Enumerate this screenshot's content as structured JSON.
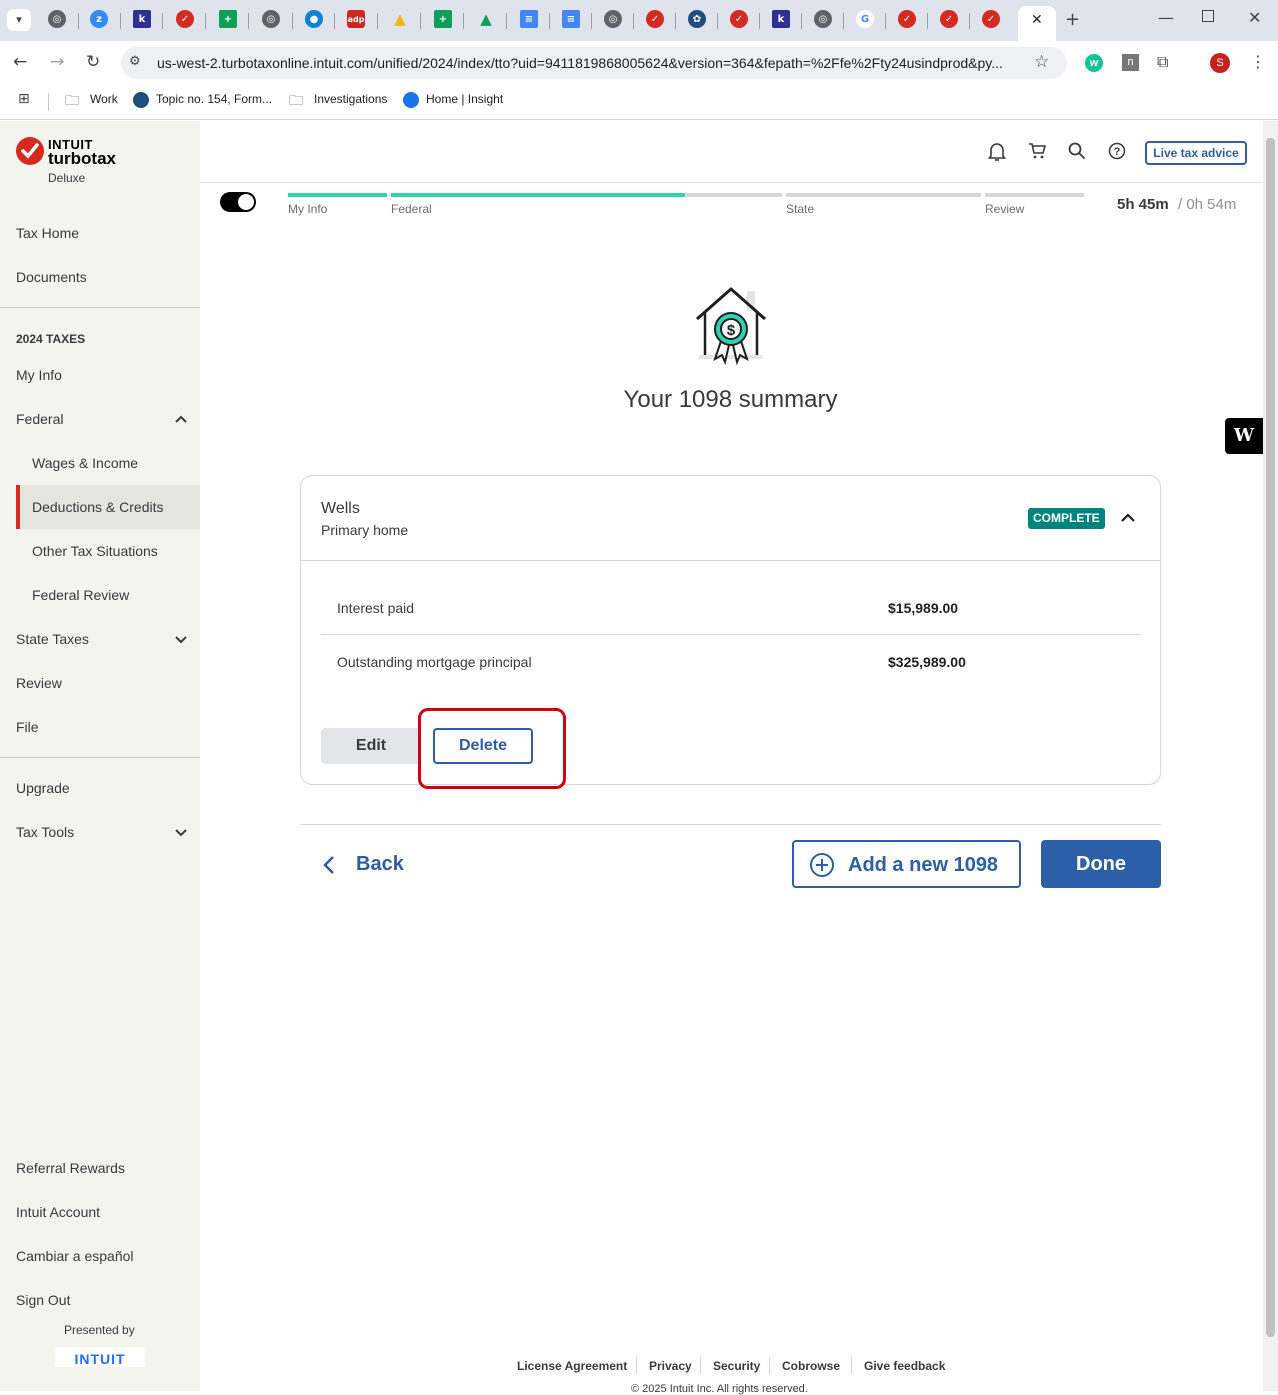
{
  "browser": {
    "url": "us-west-2.turbotaxonline.intuit.com/unified/2024/index/tto?uid=9411819868005624&version=364&fepath=%2Ffe%2Fty24usindprod&py...",
    "bookmarks": [
      {
        "label": "Work"
      },
      {
        "label": "Topic no. 154, Form..."
      },
      {
        "label": "Investigations"
      },
      {
        "label": "Home | Insight"
      }
    ],
    "profile_initial": "S"
  },
  "brand": {
    "intuit": "INTUIT",
    "name": "turbotax",
    "edition": "Deluxe"
  },
  "sidebar": {
    "tax_home": "Tax Home",
    "documents": "Documents",
    "section_heading": "2024 TAXES",
    "my_info": "My Info",
    "federal": "Federal",
    "wages": "Wages & Income",
    "deductions": "Deductions & Credits",
    "other": "Other Tax Situations",
    "federal_review": "Federal Review",
    "state_taxes": "State Taxes",
    "review": "Review",
    "file": "File",
    "upgrade": "Upgrade",
    "tax_tools": "Tax Tools",
    "referral": "Referral Rewards",
    "account": "Intuit Account",
    "spanish": "Cambiar a español",
    "sign_out": "Sign Out",
    "presented_by": "Presented by",
    "intuit_logo": "INTUIT"
  },
  "header": {
    "live_advice": "Live tax advice"
  },
  "progress": {
    "steps": [
      "My Info",
      "Federal",
      "State",
      "Review"
    ],
    "federal_fraction": 0.5,
    "time_main": "5h 45m",
    "time_sep": "/ 0h 54m"
  },
  "main": {
    "title": "Your 1098 summary",
    "card": {
      "lender": "Wells",
      "type": "Primary home",
      "status": "COMPLETE",
      "rows": [
        {
          "label": "Interest paid",
          "value": "$15,989.00"
        },
        {
          "label": "Outstanding mortgage principal",
          "value": "$325,989.00"
        }
      ],
      "edit": "Edit",
      "delete": "Delete"
    },
    "back": "Back",
    "add_new": "Add a new 1098",
    "done": "Done"
  },
  "footer": {
    "links": [
      "License Agreement",
      "Privacy",
      "Security",
      "Cobrowse",
      "Give feedback"
    ],
    "copyright": "© 2025 Intuit Inc. All rights reserved."
  },
  "colors": {
    "accent": "#236cff",
    "primary_button": "#2c5fa8",
    "complete_badge": "#008481",
    "highlight_box": "#d7000f",
    "progress_fill": "#2ed3b7"
  }
}
